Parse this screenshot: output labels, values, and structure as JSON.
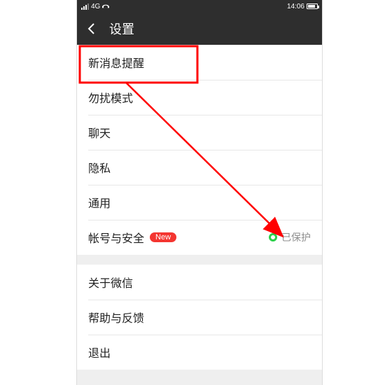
{
  "status": {
    "network": "4G",
    "time": "14:06"
  },
  "nav": {
    "title": "设置"
  },
  "group1": [
    {
      "label": "新消息提醒"
    },
    {
      "label": "勿扰模式"
    },
    {
      "label": "聊天"
    },
    {
      "label": "隐私"
    },
    {
      "label": "通用"
    },
    {
      "label": "帐号与安全",
      "badge": "New",
      "status_text": "已保护",
      "status_ok": true
    }
  ],
  "group2": [
    {
      "label": "关于微信"
    },
    {
      "label": "帮助与反馈"
    },
    {
      "label": "退出"
    }
  ]
}
